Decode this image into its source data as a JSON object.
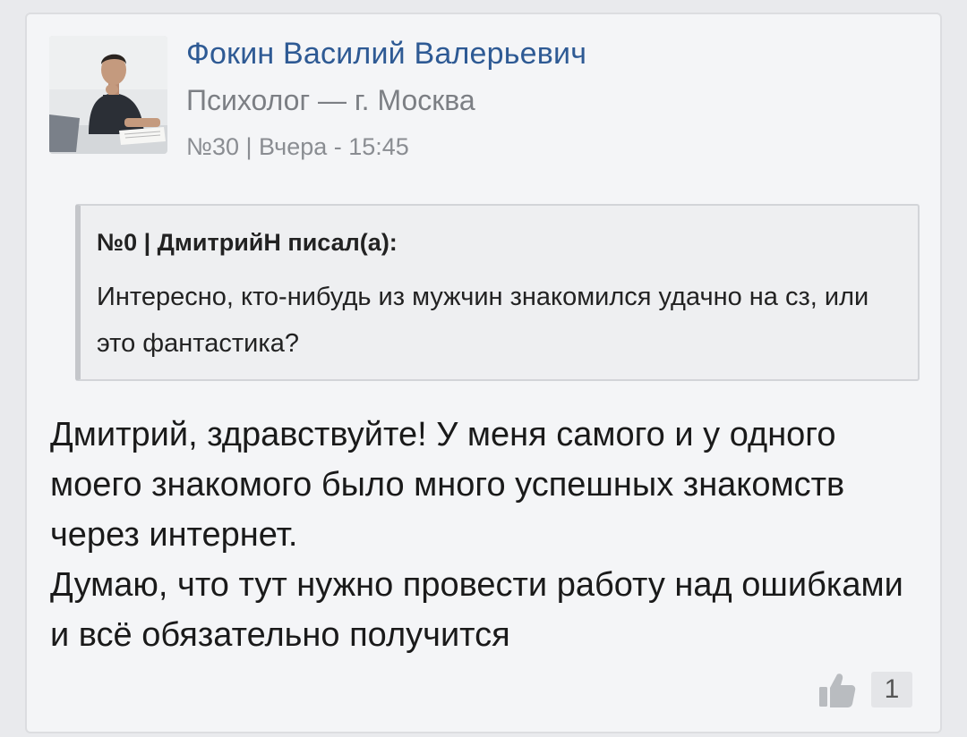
{
  "post": {
    "author": {
      "name": "Фокин Василий Валерьевич",
      "role": "Психолог — г. Москва"
    },
    "meta": "№30 | Вчера - 15:45",
    "quote": {
      "header": "№0 | ДмитрийН писал(а):",
      "text": "Интересно, кто-нибудь из мужчин знакомился удачно на сз, или это фантастика?"
    },
    "reply": {
      "paragraph1": "Дмитрий, здравствуйте! У меня самого и у одного моего знакомого было много успешных знакомств через интернет.",
      "paragraph2": "Думаю, что тут нужно провести работу над ошибками и всё обязательно получится"
    },
    "likes": {
      "icon": "thumbs-up-icon",
      "count": "1"
    }
  }
}
